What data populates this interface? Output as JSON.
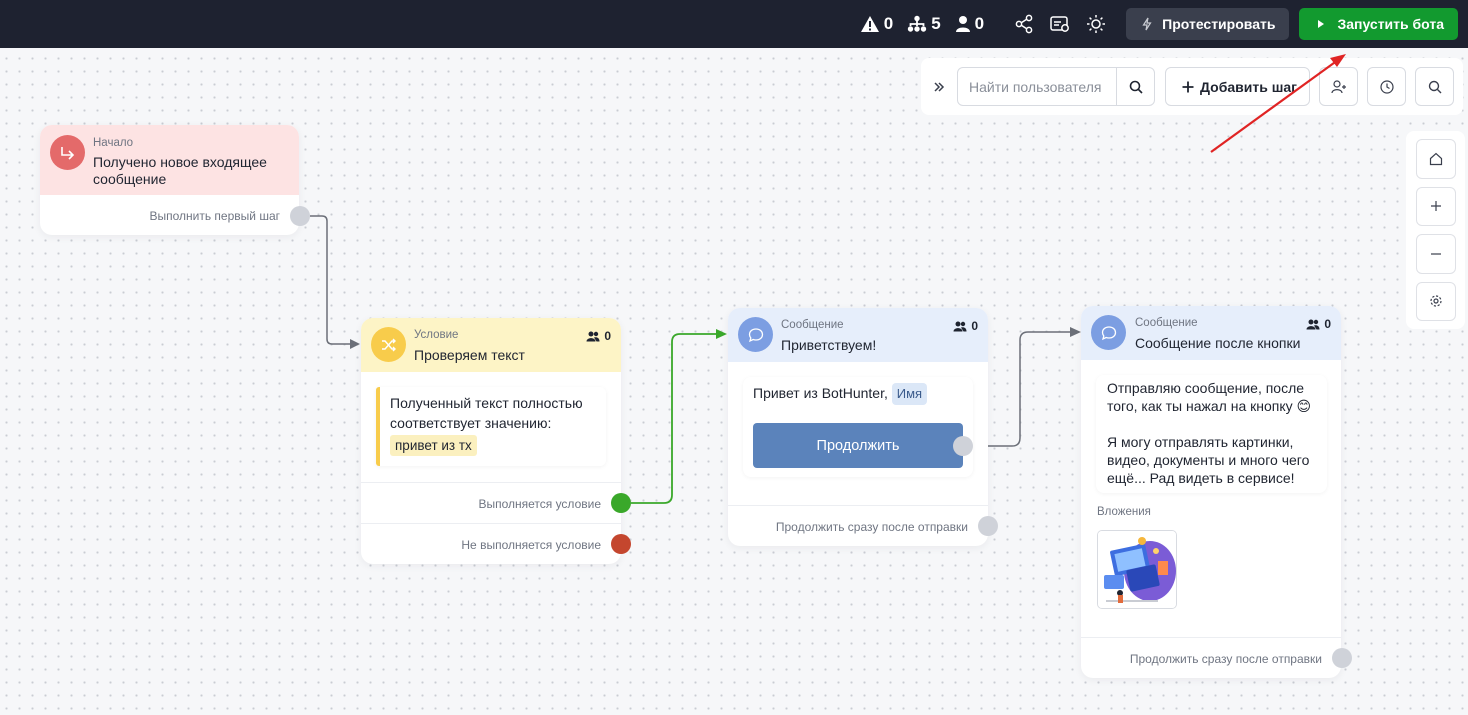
{
  "topbar": {
    "stats": [
      {
        "icon": "warning-icon",
        "value": "0"
      },
      {
        "icon": "hierarchy-icon",
        "value": "5"
      },
      {
        "icon": "user-icon",
        "value": "0"
      }
    ],
    "icons": [
      "share-icon",
      "settings-card-icon",
      "sun-icon"
    ],
    "test_label": "Протестировать",
    "run_label": "Запустить бота",
    "colors": {
      "bar": "#1e2230",
      "run": "#129a2f",
      "test": "#3a3f4d"
    }
  },
  "toolbar": {
    "search_placeholder": "Найти пользователя",
    "add_step_label": "Добавить шаг"
  },
  "nodes": {
    "start": {
      "type": "Начало",
      "title": "Получено новое входящее сообщение",
      "output": "Выполнить первый шаг",
      "color": "#fde3e3",
      "icon_color": "#e46a6a"
    },
    "condition": {
      "type": "Условие",
      "title": "Проверяем текст",
      "count": "0",
      "rule_text": "Полученный текст полностью соответствует значению:",
      "value": "привет из тх",
      "out_true": "Выполняется условие",
      "out_false": "Не выполняется условие",
      "color": "#fdf4c6",
      "icon_color": "#f8cc4b"
    },
    "greeting": {
      "type": "Сообщение",
      "title": "Приветствуем!",
      "count": "0",
      "text": "Привет из BotHunter,",
      "variable": "Имя",
      "button": "Продолжить",
      "output": "Продолжить сразу после отправки",
      "color": "#e6eefb",
      "icon_color": "#7c9ee2"
    },
    "after_button": {
      "type": "Сообщение",
      "title": "Сообщение после кнопки",
      "count": "0",
      "text_line1": "Отправляю сообщение, после того, как ты нажал на кнопку 😊",
      "text_line2": "Я могу отправлять картинки, видео, документы и много чего ещё... Рад видеть в сервисе!",
      "attachments_label": "Вложения",
      "output": "Продолжить сразу после отправки",
      "color": "#e6eefb",
      "icon_color": "#7c9ee2"
    }
  },
  "wire_colors": {
    "default": "#6b6f78",
    "success": "#3aa82a",
    "fail": "#c4462e",
    "arrow": "#e02424"
  }
}
